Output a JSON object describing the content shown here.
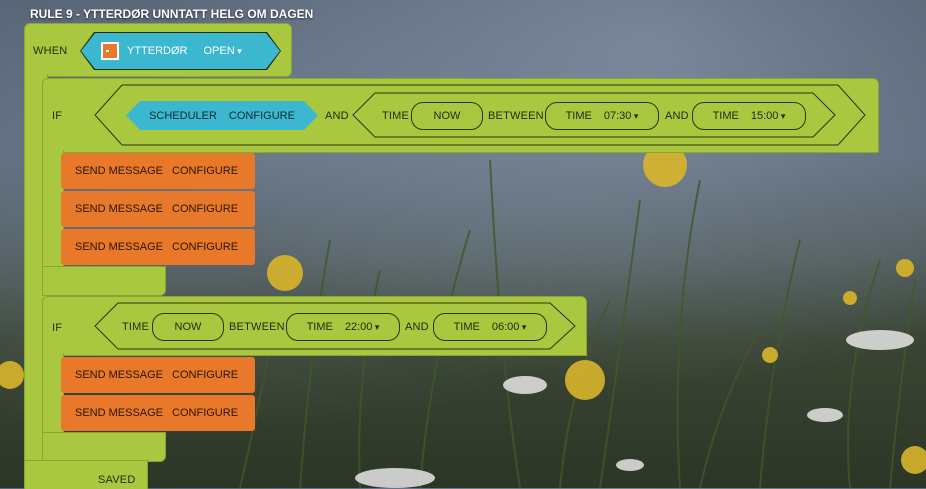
{
  "rule_title": "RULE 9 - YTTERDØR UNNTATT HELG OM DAGEN",
  "when": {
    "label": "WHEN",
    "device": "YTTERDØR",
    "device_icon": "door-icon",
    "state": "OPEN"
  },
  "if1": {
    "label": "IF",
    "scheduler": {
      "label": "SCHEDULER",
      "action": "CONFIGURE"
    },
    "and_label": "AND",
    "time_label": "TIME",
    "now": "NOW",
    "between": "BETWEEN",
    "start": {
      "label": "TIME",
      "value": "07:30"
    },
    "and2_label": "AND",
    "end": {
      "label": "TIME",
      "value": "15:00"
    },
    "actions": [
      {
        "label": "SEND MESSAGE",
        "action": "CONFIGURE"
      },
      {
        "label": "SEND MESSAGE",
        "action": "CONFIGURE"
      },
      {
        "label": "SEND MESSAGE",
        "action": "CONFIGURE"
      }
    ]
  },
  "if2": {
    "label": "IF",
    "time_label": "TIME",
    "now": "NOW",
    "between": "BETWEEN",
    "start": {
      "label": "TIME",
      "value": "22:00"
    },
    "and_label": "AND",
    "end": {
      "label": "TIME",
      "value": "06:00"
    },
    "actions": [
      {
        "label": "SEND MESSAGE",
        "action": "CONFIGURE"
      },
      {
        "label": "SEND MESSAGE",
        "action": "CONFIGURE"
      }
    ]
  },
  "status": "SAVED",
  "colors": {
    "block_green": "#a9c840",
    "block_blue": "#3bb8cf",
    "block_orange": "#e8792a"
  }
}
